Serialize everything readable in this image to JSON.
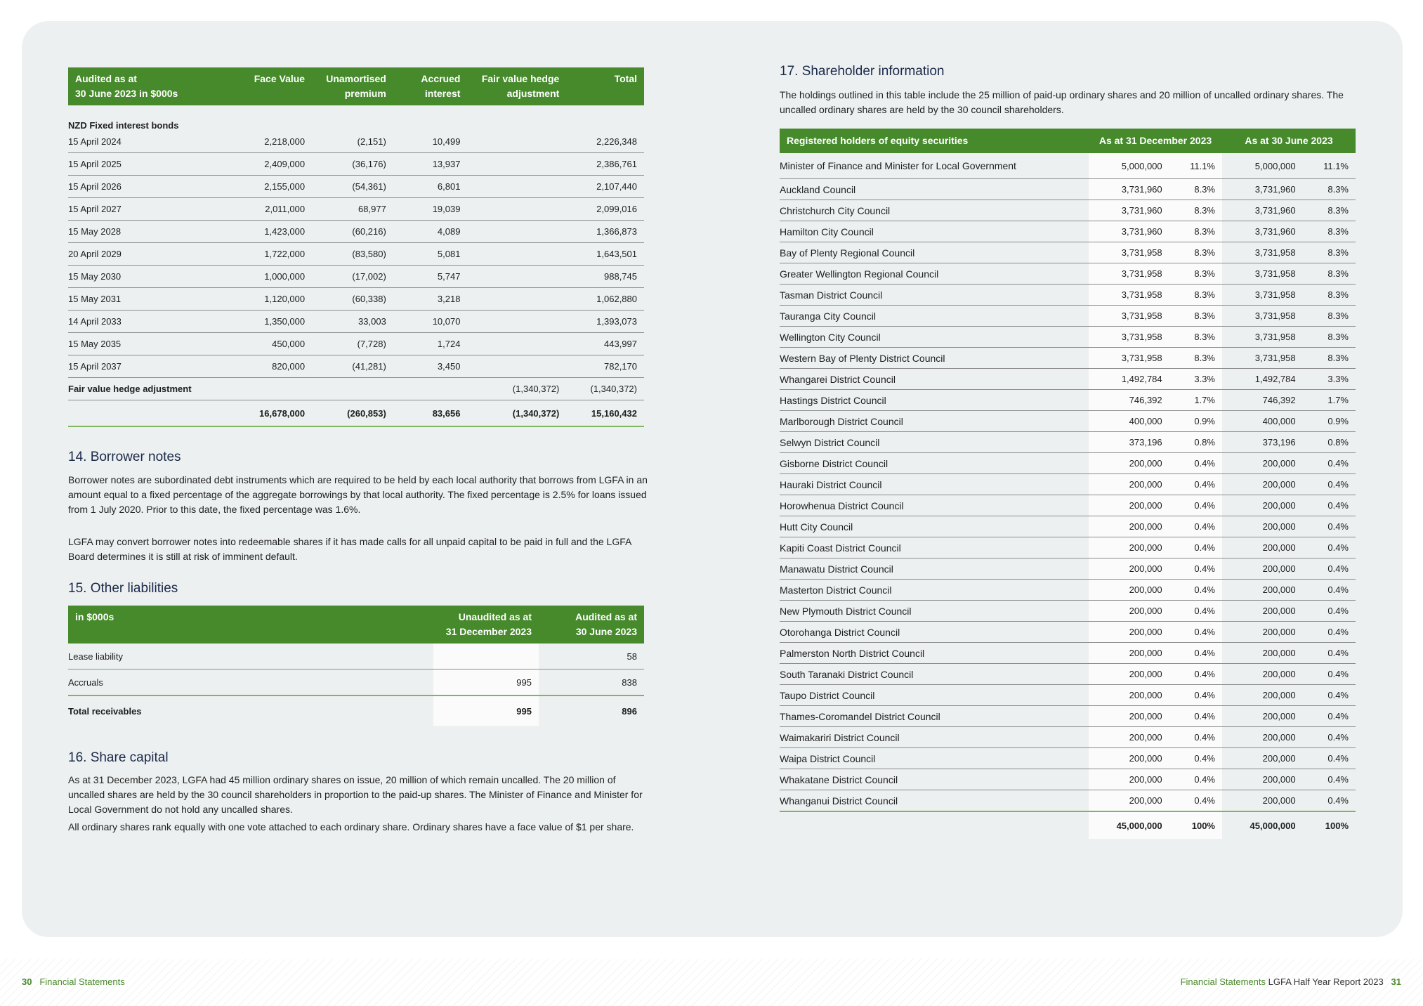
{
  "bonds": {
    "headers": [
      "Audited as at\n30 June 2023 in $000s",
      "Face Value",
      "Unamortised premium",
      "Accrued interest",
      "Fair value hedge adjustment",
      "Total"
    ],
    "group_label": "NZD Fixed interest bonds",
    "rows": [
      [
        "15 April 2024",
        "2,218,000",
        "(2,151)",
        "10,499",
        "",
        "2,226,348"
      ],
      [
        "15 April 2025",
        "2,409,000",
        "(36,176)",
        "13,937",
        "",
        "2,386,761"
      ],
      [
        "15 April 2026",
        "2,155,000",
        "(54,361)",
        "6,801",
        "",
        "2,107,440"
      ],
      [
        "15 April 2027",
        "2,011,000",
        "68,977",
        "19,039",
        "",
        "2,099,016"
      ],
      [
        "15 May 2028",
        "1,423,000",
        "(60,216)",
        "4,089",
        "",
        "1,366,873"
      ],
      [
        "20 April 2029",
        "1,722,000",
        "(83,580)",
        "5,081",
        "",
        "1,643,501"
      ],
      [
        "15 May 2030",
        "1,000,000",
        "(17,002)",
        "5,747",
        "",
        "988,745"
      ],
      [
        "15 May 2031",
        "1,120,000",
        "(60,338)",
        "3,218",
        "",
        "1,062,880"
      ],
      [
        "14 April 2033",
        "1,350,000",
        "33,003",
        "10,070",
        "",
        "1,393,073"
      ],
      [
        "15 May 2035",
        "450,000",
        "(7,728)",
        "1,724",
        "",
        "443,997"
      ],
      [
        "15 April 2037",
        "820,000",
        "(41,281)",
        "3,450",
        "",
        "782,170"
      ]
    ],
    "fv_row": [
      "Fair value hedge adjustment",
      "",
      "",
      "",
      "(1,340,372)",
      "(1,340,372)"
    ],
    "total_row": [
      "",
      "16,678,000",
      "(260,853)",
      "83,656",
      "(1,340,372)",
      "15,160,432"
    ]
  },
  "borrower_notes": {
    "title": "14. Borrower notes",
    "p1": "Borrower notes are subordinated debt instruments which are required to be held by each local authority that borrows from LGFA in an amount equal to a fixed percentage of the aggregate borrowings by that local authority. The fixed percentage is 2.5% for loans issued from 1 July 2020. Prior to this date, the fixed percentage was 1.6%.",
    "p2": "LGFA may convert borrower notes into redeemable shares if it has made calls for all unpaid capital to be paid in full and the LGFA Board determines it is still at risk of imminent default."
  },
  "other_liabilities": {
    "title": "15. Other liabilities",
    "headers": [
      "in $000s",
      "Unaudited as at\n31 December 2023",
      "Audited as at\n30 June 2023"
    ],
    "rows": [
      [
        "Lease liability",
        "",
        "58"
      ],
      [
        "Accruals",
        "995",
        "838"
      ]
    ],
    "total_row": [
      "Total receivables",
      "995",
      "896"
    ]
  },
  "share_capital": {
    "title": "16. Share capital",
    "p1": "As at 31 December 2023, LGFA had 45 million ordinary shares on issue, 20 million of which remain uncalled. The 20 million of uncalled shares are held by the 30 council shareholders in proportion to the paid-up shares. The Minister of Finance and Minister for Local Government do not hold any uncalled shares.",
    "p2": "All ordinary shares rank equally with one vote attached to each ordinary share. Ordinary shares have a face value of $1 per share."
  },
  "shareholders": {
    "title": "17. Shareholder information",
    "intro": "The holdings outlined in this table include the 25 million of paid-up ordinary shares and 20 million of uncalled ordinary shares. The uncalled ordinary shares are held by the 30 council shareholders.",
    "headers": [
      "Registered holders of equity securities",
      "As at 31 December 2023",
      "As at 30 June 2023"
    ],
    "rows": [
      [
        "Minister of Finance and Minister for Local Government",
        "5,000,000",
        "11.1%",
        "5,000,000",
        "11.1%"
      ],
      [
        "Auckland Council",
        "3,731,960",
        "8.3%",
        "3,731,960",
        "8.3%"
      ],
      [
        "Christchurch City Council",
        "3,731,960",
        "8.3%",
        "3,731,960",
        "8.3%"
      ],
      [
        "Hamilton City Council",
        "3,731,960",
        "8.3%",
        "3,731,960",
        "8.3%"
      ],
      [
        "Bay of Plenty Regional Council",
        "3,731,958",
        "8.3%",
        "3,731,958",
        "8.3%"
      ],
      [
        "Greater Wellington Regional Council",
        "3,731,958",
        "8.3%",
        "3,731,958",
        "8.3%"
      ],
      [
        "Tasman District Council",
        "3,731,958",
        "8.3%",
        "3,731,958",
        "8.3%"
      ],
      [
        "Tauranga City Council",
        "3,731,958",
        "8.3%",
        "3,731,958",
        "8.3%"
      ],
      [
        "Wellington City Council",
        "3,731,958",
        "8.3%",
        "3,731,958",
        "8.3%"
      ],
      [
        "Western Bay of Plenty District Council",
        "3,731,958",
        "8.3%",
        "3,731,958",
        "8.3%"
      ],
      [
        "Whangarei District Council",
        "1,492,784",
        "3.3%",
        "1,492,784",
        "3.3%"
      ],
      [
        "Hastings District Council",
        "746,392",
        "1.7%",
        "746,392",
        "1.7%"
      ],
      [
        "Marlborough District Council",
        "400,000",
        "0.9%",
        "400,000",
        "0.9%"
      ],
      [
        "Selwyn District Council",
        "373,196",
        "0.8%",
        "373,196",
        "0.8%"
      ],
      [
        "Gisborne District Council",
        "200,000",
        "0.4%",
        "200,000",
        "0.4%"
      ],
      [
        "Hauraki District Council",
        "200,000",
        "0.4%",
        "200,000",
        "0.4%"
      ],
      [
        "Horowhenua District Council",
        "200,000",
        "0.4%",
        "200,000",
        "0.4%"
      ],
      [
        "Hutt City Council",
        "200,000",
        "0.4%",
        "200,000",
        "0.4%"
      ],
      [
        "Kapiti Coast District Council",
        "200,000",
        "0.4%",
        "200,000",
        "0.4%"
      ],
      [
        "Manawatu District Council",
        "200,000",
        "0.4%",
        "200,000",
        "0.4%"
      ],
      [
        "Masterton District Council",
        "200,000",
        "0.4%",
        "200,000",
        "0.4%"
      ],
      [
        "New Plymouth District Council",
        "200,000",
        "0.4%",
        "200,000",
        "0.4%"
      ],
      [
        "Otorohanga District Council",
        "200,000",
        "0.4%",
        "200,000",
        "0.4%"
      ],
      [
        "Palmerston North District Council",
        "200,000",
        "0.4%",
        "200,000",
        "0.4%"
      ],
      [
        "South Taranaki District Council",
        "200,000",
        "0.4%",
        "200,000",
        "0.4%"
      ],
      [
        "Taupo District Council",
        "200,000",
        "0.4%",
        "200,000",
        "0.4%"
      ],
      [
        "Thames-Coromandel District Council",
        "200,000",
        "0.4%",
        "200,000",
        "0.4%"
      ],
      [
        "Waimakariri District Council",
        "200,000",
        "0.4%",
        "200,000",
        "0.4%"
      ],
      [
        "Waipa District Council",
        "200,000",
        "0.4%",
        "200,000",
        "0.4%"
      ],
      [
        "Whakatane District Council",
        "200,000",
        "0.4%",
        "200,000",
        "0.4%"
      ],
      [
        "Whanganui District Council",
        "200,000",
        "0.4%",
        "200,000",
        "0.4%"
      ]
    ],
    "total_row": [
      "",
      "45,000,000",
      "100%",
      "45,000,000",
      "100%"
    ]
  },
  "footer": {
    "left_page": "30",
    "left_section": "Financial Statements",
    "right_section": "Financial Statements",
    "right_report": "LGFA Half Year Report 2023",
    "right_page": "31"
  },
  "colors": {
    "header_green": "#468a2c",
    "panel_bg": "#edf0f0",
    "accent_rule": "#7fb55f"
  }
}
